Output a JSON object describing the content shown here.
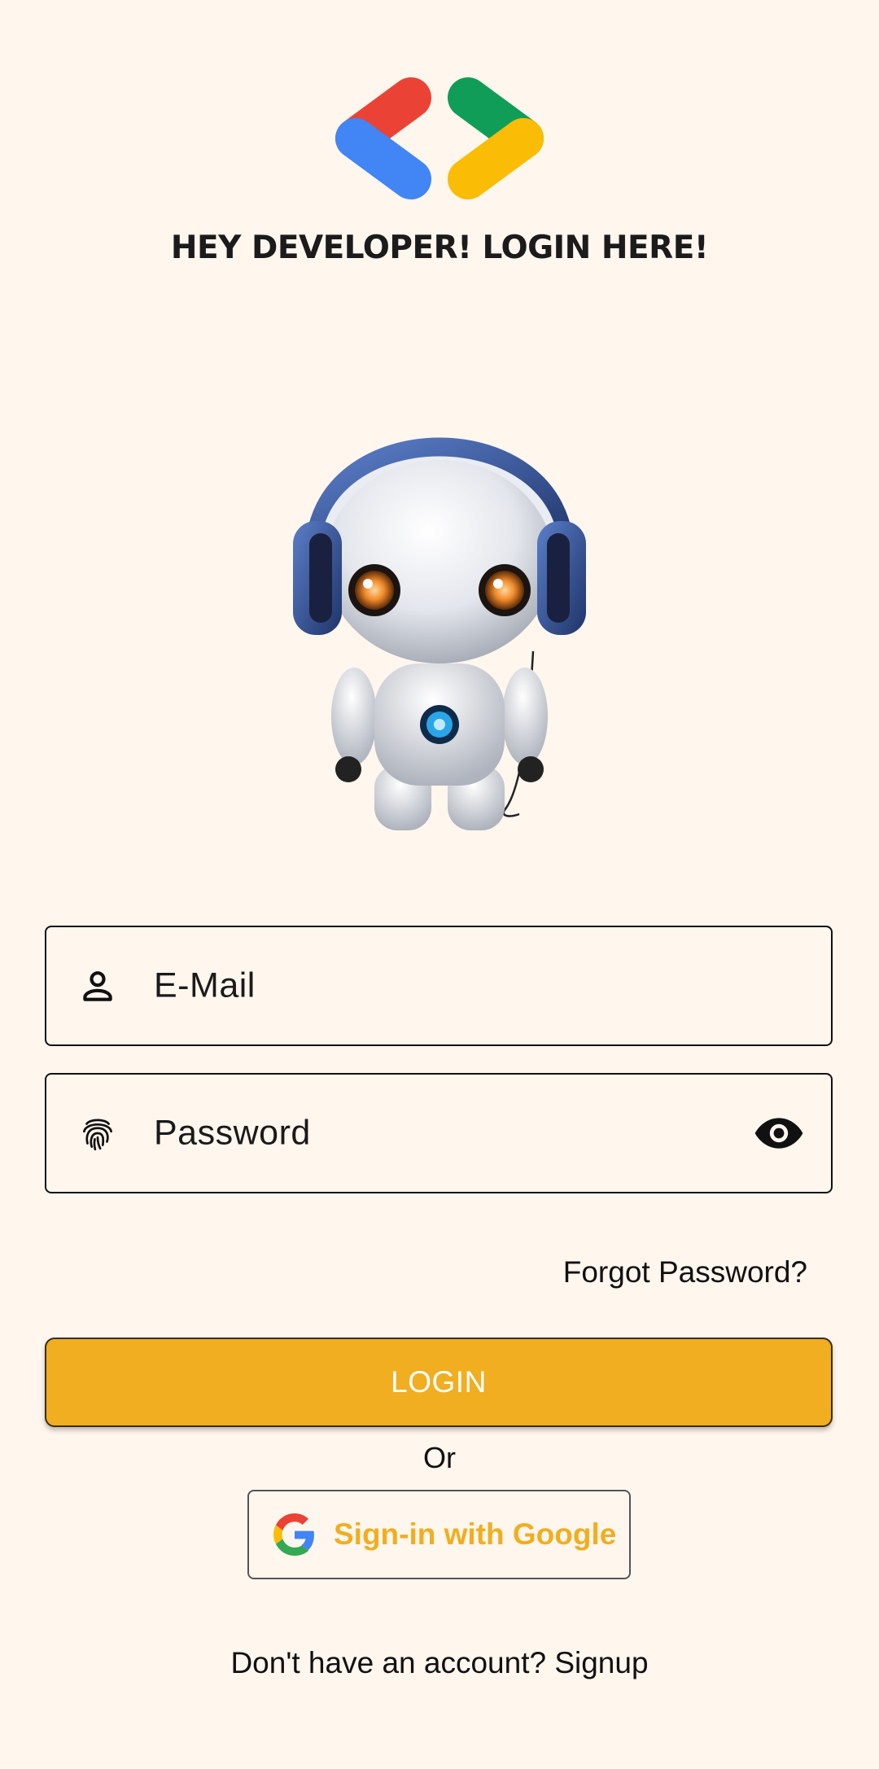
{
  "header": {
    "logo_icon": "developer-brackets-logo",
    "title": "HEY DEVELOPER! LOGIN HERE!"
  },
  "illustration": {
    "icon": "robot-with-headphones"
  },
  "form": {
    "email": {
      "placeholder": "E-Mail",
      "icon": "person-icon"
    },
    "password": {
      "placeholder": "Password",
      "icon": "fingerprint-icon",
      "toggle_icon": "eye-icon"
    },
    "forgot_label": "Forgot Password?",
    "login_label": "LOGIN",
    "or_label": "Or",
    "google_label": "Sign-in with Google",
    "signup_label": "Don't have an account? Signup"
  },
  "colors": {
    "background": "#FFF6EE",
    "accent": "#F0AE20",
    "logo_red": "#EA4335",
    "logo_blue": "#4285F4",
    "logo_green": "#0F9D58",
    "logo_yellow": "#FBBC05"
  }
}
